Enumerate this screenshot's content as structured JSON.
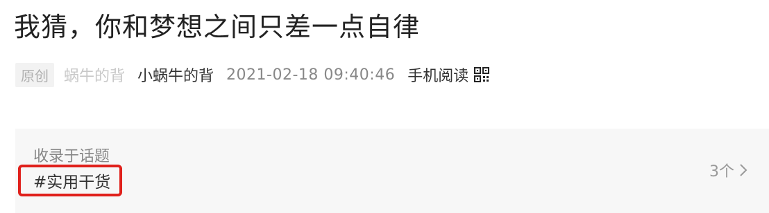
{
  "article": {
    "title": "我猜，你和梦想之间只差一点自律",
    "badge": "原创",
    "account_name": "蜗牛的背",
    "author": "小蜗牛的背",
    "datetime": "2021-02-18 09:40:46",
    "listen_label": "手机阅读",
    "listen_icon": "headphone-icon"
  },
  "topic": {
    "caption": "收录于话题",
    "tag": "#实用干货",
    "count": "3个",
    "count_icon": "chevron-right-icon",
    "highlight_color": "#e0201b"
  }
}
